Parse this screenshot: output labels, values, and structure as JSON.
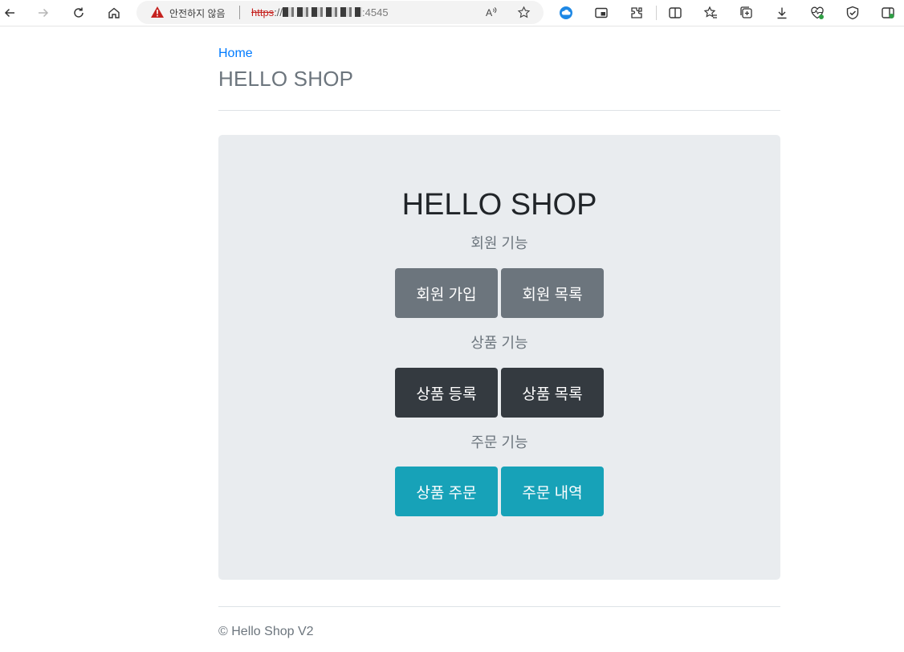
{
  "browser": {
    "security_label": "안전하지 않음",
    "url_protocol": "https",
    "url_separator": "://",
    "url_port": ":4545",
    "icons": [
      "back-arrow-icon",
      "forward-arrow-icon",
      "reload-icon",
      "home-icon",
      "warning-icon",
      "read-aloud-icon",
      "favorite-star-icon",
      "cloud-sync-icon",
      "picture-in-picture-icon",
      "extensions-icon",
      "split-screen-icon",
      "favorites-icon",
      "collections-icon",
      "download-icon",
      "performance-icon",
      "browser-essentials-icon",
      "profile-sidebar-icon"
    ]
  },
  "header": {
    "home_link": "Home",
    "brand": "HELLO SHOP"
  },
  "jumbotron": {
    "title": "HELLO SHOP",
    "sections": [
      {
        "label": "회원 기능",
        "buttons": [
          "회원 가입",
          "회원 목록"
        ],
        "color": "#6c757d"
      },
      {
        "label": "상품 기능",
        "buttons": [
          "상품 등록",
          "상품 목록"
        ],
        "color": "#343a40"
      },
      {
        "label": "주문 기능",
        "buttons": [
          "상품 주문",
          "주문 내역"
        ],
        "color": "#17a2b8"
      }
    ]
  },
  "footer": {
    "text": "© Hello Shop V2"
  },
  "colors": {
    "link": "#007bff",
    "jumbotron_bg": "#e9ecef",
    "warning": "#c5221f"
  }
}
